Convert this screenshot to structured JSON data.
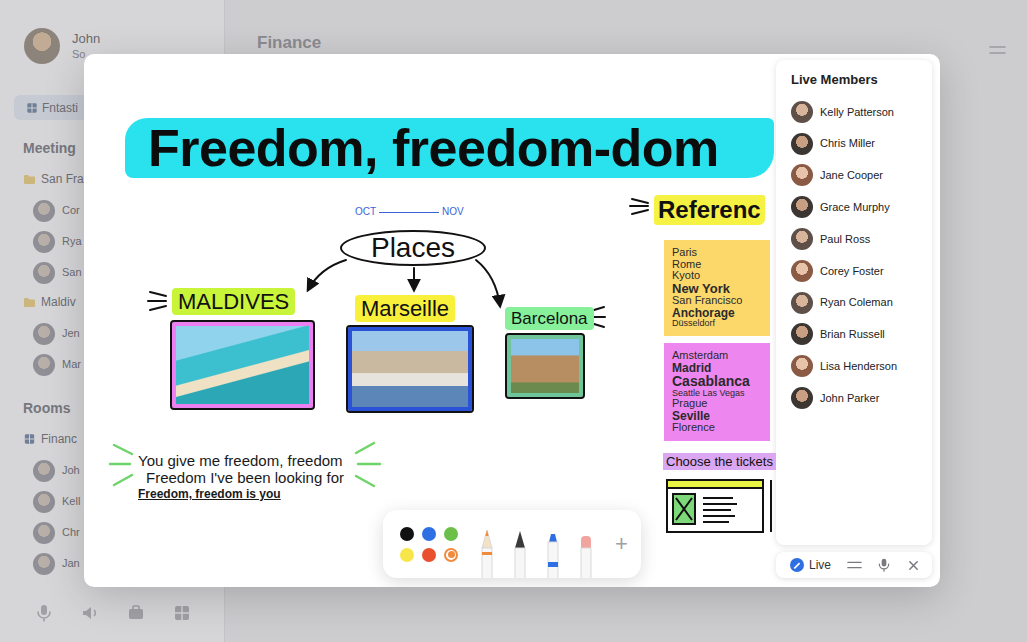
{
  "app": {
    "user": {
      "name": "John",
      "status": "So"
    },
    "header": {
      "title": "Finance"
    },
    "workspace": {
      "label": "Fntasti",
      "selected": true
    },
    "sections": [
      {
        "title": "Meeting",
        "groups": [
          {
            "label": "San Fra",
            "kind": "folder",
            "members": [
              "Cor",
              "Rya",
              "San"
            ]
          },
          {
            "label": "Maldiv",
            "kind": "folder",
            "members": [
              "Jen",
              "Mar"
            ]
          }
        ]
      },
      {
        "title": "Rooms",
        "groups": [
          {
            "label": "Financ",
            "kind": "room",
            "members": [
              "Joh",
              "Kell",
              "Chr",
              "Jan"
            ]
          }
        ]
      }
    ]
  },
  "board": {
    "title": "Freedom, freedom-dom",
    "timeline": {
      "start": "OCT",
      "end": "NOV"
    },
    "hub": "Places",
    "places": [
      {
        "label": "MALDIVES",
        "color": "#c8f53a"
      },
      {
        "label": "Marseille",
        "color": "#f9f03c"
      },
      {
        "label": "Barcelona",
        "color": "#86f09a"
      }
    ],
    "lyrics": [
      "You give me freedom, freedom",
      "Freedom I've been looking for",
      "Freedom, freedom is you"
    ],
    "references": {
      "title": "Referenc",
      "notes": [
        {
          "color": "#fcd86a",
          "entries": [
            {
              "text": "Paris",
              "kind": "small"
            },
            {
              "text": "Rome",
              "kind": "small"
            },
            {
              "text": "Kyoto",
              "kind": "small"
            },
            {
              "text": "New York",
              "kind": "large"
            },
            {
              "text": "San Francisco",
              "kind": "small"
            },
            {
              "text": "Anchorage",
              "kind": "medium"
            },
            {
              "text": "Düsseldorf",
              "kind": "tiny"
            }
          ]
        },
        {
          "color": "#ee86f0",
          "entries": [
            {
              "text": "Amsterdam",
              "kind": "small"
            },
            {
              "text": "Madrid",
              "kind": "medium"
            },
            {
              "text": "Casablanca",
              "kind": "xlarge"
            },
            {
              "text": "Seattle Las Vegas",
              "kind": "tiny"
            },
            {
              "text": "Prague",
              "kind": "small"
            },
            {
              "text": "Seville",
              "kind": "medium"
            },
            {
              "text": "Florence",
              "kind": "small"
            }
          ]
        }
      ]
    },
    "tickets": {
      "title": "Choose the tickets"
    }
  },
  "toolbar": {
    "colors": [
      {
        "color": "#111111",
        "selected": false
      },
      {
        "color": "#2f6fe4",
        "selected": false
      },
      {
        "color": "#6cc04a",
        "selected": false
      },
      {
        "color": "#f7e64a",
        "selected": false
      },
      {
        "color": "#e8502e",
        "selected": false
      },
      {
        "color": "#f08a3c",
        "selected": true
      }
    ],
    "tools": [
      {
        "kind": "pencil"
      },
      {
        "kind": "pen"
      },
      {
        "kind": "marker"
      },
      {
        "kind": "eraser"
      }
    ],
    "add": "+"
  },
  "members": {
    "title": "Live Members",
    "items": [
      {
        "name": "Kelly Patterson"
      },
      {
        "name": "Chris Miller"
      },
      {
        "name": "Jane Cooper"
      },
      {
        "name": "Grace Murphy"
      },
      {
        "name": "Paul Ross"
      },
      {
        "name": "Corey Foster"
      },
      {
        "name": "Ryan Coleman"
      },
      {
        "name": "Brian Russell"
      },
      {
        "name": "Lisa Henderson"
      },
      {
        "name": "John Parker"
      }
    ]
  },
  "live_bar": {
    "label": "Live"
  }
}
